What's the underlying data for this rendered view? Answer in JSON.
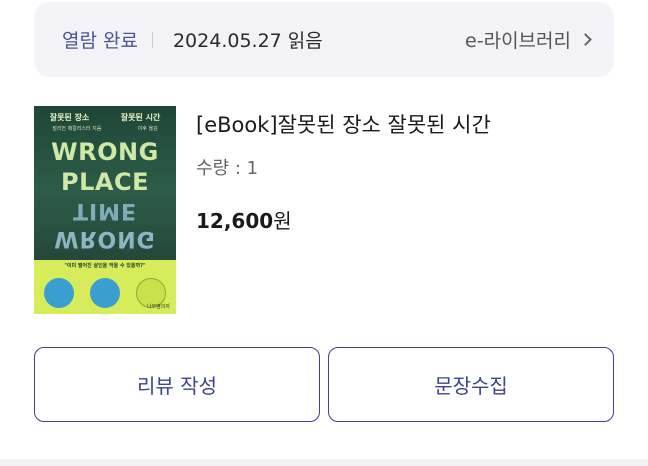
{
  "status": {
    "label": "열람 완료",
    "date": "2024.05.27 읽음",
    "library_link": "e-라이브러리"
  },
  "book": {
    "title": "[eBook]잘못된 장소 잘못된 시간",
    "quantity": "수량 : 1",
    "price": "12,600",
    "currency": "원",
    "cover": {
      "title_ko_left": "잘못된 장소",
      "title_ko_right": "잘못된 시간",
      "authors_left": "질리언 매칼리스터 지음",
      "authors_right": "이후 옮김",
      "title_en_line1": "WRONG",
      "title_en_line2": "PLACE",
      "title_en_line3": "TIME",
      "title_en_line4": "WRONG",
      "quote": "\"이미 벌어진 살인을 막을 수 있을까?\"",
      "publisher": "나무옆의자"
    }
  },
  "actions": {
    "review": "리뷰 작성",
    "quote_collect": "문장수집"
  },
  "colors": {
    "accent": "#3e4290",
    "status_bg": "#f3f3f7",
    "cover_green": "#d6ec5a"
  },
  "icons": {
    "chevron": "chevron-right-icon"
  }
}
